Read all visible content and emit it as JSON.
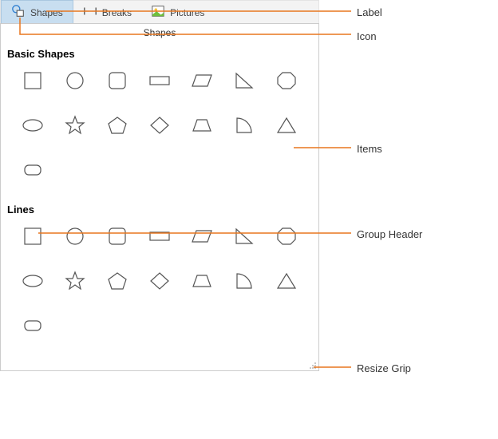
{
  "ribbon": {
    "items": [
      {
        "label": "Shapes",
        "icon": "shapes"
      },
      {
        "label": "Breaks",
        "icon": "breaks"
      },
      {
        "label": "Pictures",
        "icon": "pictures"
      }
    ],
    "active_index": 0
  },
  "panel": {
    "title": "Shapes",
    "groups": [
      {
        "header": "Basic Shapes",
        "items": [
          "square",
          "circle",
          "rounded-square",
          "rectangle",
          "parallelogram",
          "right-triangle",
          "octagon",
          "ellipse",
          "star",
          "pentagon",
          "diamond",
          "trapezoid",
          "quarter-pie",
          "triangle",
          "tab-rect"
        ]
      },
      {
        "header": "Lines",
        "items": [
          "square",
          "circle",
          "rounded-square",
          "rectangle",
          "parallelogram",
          "right-triangle",
          "octagon",
          "ellipse",
          "star",
          "pentagon",
          "diamond",
          "trapezoid",
          "quarter-pie",
          "triangle",
          "tab-rect"
        ]
      }
    ]
  },
  "callouts": {
    "label": "Label",
    "icon": "Icon",
    "items": "Items",
    "group_header": "Group Header",
    "resize_grip": "Resize Grip"
  },
  "colors": {
    "accent": "#e8771f",
    "ribbon_bg": "#f3f3f3",
    "active_bg": "#c8def0"
  }
}
